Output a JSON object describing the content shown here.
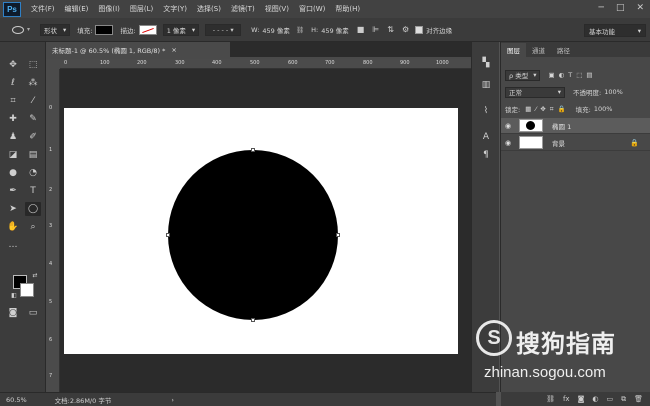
{
  "app": {
    "logo": "Ps"
  },
  "menu": [
    "文件(F)",
    "编辑(E)",
    "图像(I)",
    "图层(L)",
    "文字(Y)",
    "选择(S)",
    "滤镜(T)",
    "视图(V)",
    "窗口(W)",
    "帮助(H)"
  ],
  "window_controls": [
    "─",
    "□",
    "✕"
  ],
  "options": {
    "mode": "形状",
    "fill_label": "填充:",
    "stroke_label": "描边:",
    "stroke_width": "1 像素",
    "width_label": "W:",
    "width_value": "459 像素",
    "height_label": "H:",
    "height_value": "459 像素",
    "align_edges": "对齐边缘",
    "workspace": "基本功能"
  },
  "document": {
    "tab_title": "未标题-1 @ 60.5% (椭圆 1, RGB/8) *",
    "close": "×",
    "ruler_h": [
      "0",
      "100",
      "200",
      "300",
      "400",
      "500",
      "600",
      "700",
      "800",
      "900",
      "1000"
    ],
    "ruler_v": [
      "0",
      "1",
      "2",
      "3",
      "4",
      "5",
      "6",
      "7"
    ]
  },
  "status": {
    "zoom": "60.5%",
    "doc_info": "文档:2.86M/0 字节"
  },
  "layers_panel": {
    "tabs": [
      "图层",
      "通道",
      "路径"
    ],
    "filter": "ρ 类型",
    "blend_mode": "正常",
    "opacity_label": "不透明度:",
    "opacity_value": "100%",
    "lock_label": "锁定:",
    "fill_label": "填充:",
    "fill_value": "100%",
    "layers": [
      {
        "name": "椭圆 1",
        "visible": true,
        "selected": true
      },
      {
        "name": "背景",
        "visible": true,
        "selected": false,
        "locked": true
      }
    ],
    "footer_icons": [
      "link-icon",
      "fx-icon",
      "mask-icon",
      "adjustment-icon",
      "folder-icon",
      "new-layer-icon",
      "trash-icon"
    ]
  },
  "watermark": {
    "logo": "S",
    "brand": "搜狗指南",
    "url": "zhinan.sogou.com"
  }
}
